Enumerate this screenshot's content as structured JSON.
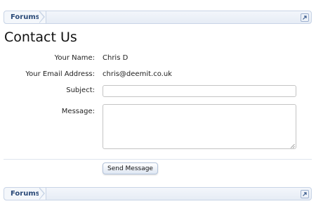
{
  "breadcrumb": {
    "top_label": "Forums",
    "bottom_label": "Forums"
  },
  "page": {
    "title": "Contact Us"
  },
  "form": {
    "name_label": "Your Name:",
    "name_value": "Chris D",
    "email_label": "Your Email Address:",
    "email_value": "chris@deemit.co.uk",
    "subject_label": "Subject:",
    "subject_value": "",
    "message_label": "Message:",
    "message_value": "",
    "submit_label": "Send Message"
  },
  "colors": {
    "breadcrumb_text": "#2b4a78",
    "breadcrumb_border": "#c8d4e6",
    "button_bg": "#dfe7f3"
  },
  "icons": {
    "jump": "jump-to-icon",
    "resize": "resize-grip-icon"
  }
}
